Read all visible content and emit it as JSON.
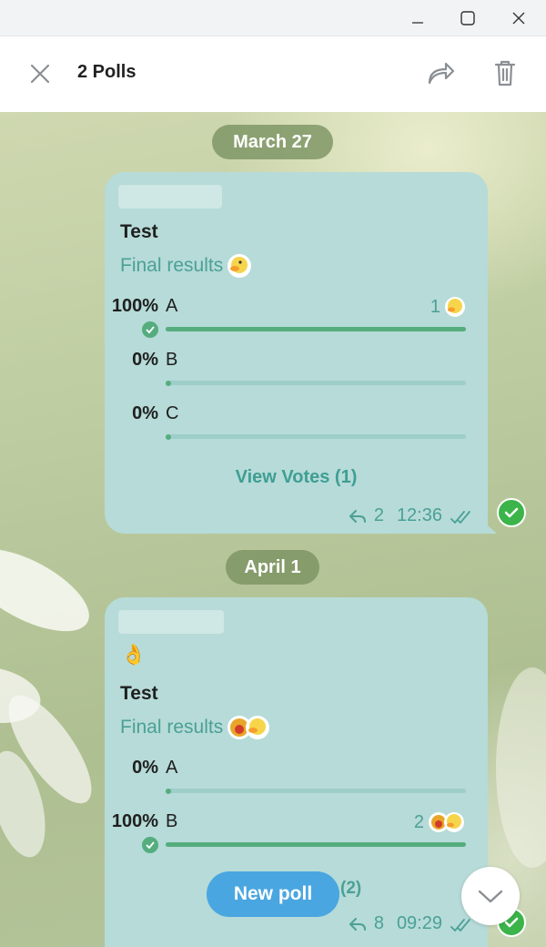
{
  "window": {
    "minimize_icon": "minimize-icon",
    "maximize_icon": "maximize-icon",
    "close_icon": "close-icon"
  },
  "header": {
    "title": "2 Polls",
    "close_icon": "close-icon",
    "forward_icon": "forward-icon",
    "delete_icon": "trash-icon"
  },
  "messages": [
    {
      "date": "March 27",
      "emoji": "",
      "question": "Test",
      "status": "Final results",
      "options": [
        {
          "percent": "100%",
          "label": "A",
          "votes": "1",
          "fill": 1.0,
          "chosen": true
        },
        {
          "percent": "0%",
          "label": "B",
          "votes": "",
          "fill": 0,
          "chosen": false
        },
        {
          "percent": "0%",
          "label": "C",
          "votes": "",
          "fill": 0,
          "chosen": false
        }
      ],
      "view_votes": "View Votes (1)",
      "replies": "2",
      "time": "12:36",
      "selected": true
    },
    {
      "date": "April 1",
      "emoji": "👌",
      "question": "Test",
      "status": "Final results",
      "options": [
        {
          "percent": "0%",
          "label": "A",
          "votes": "",
          "fill": 0,
          "chosen": false
        },
        {
          "percent": "100%",
          "label": "B",
          "votes": "2",
          "fill": 1.0,
          "chosen": true
        }
      ],
      "vote_count": "(2)",
      "replies": "8",
      "time": "09:29",
      "selected": true
    }
  ],
  "new_poll_label": "New poll",
  "colors": {
    "bubble": "#b6dbd8",
    "accent": "#4ba096",
    "bar": "#55ad7e",
    "button": "#4aa6e0",
    "selected": "#3bb44a"
  }
}
